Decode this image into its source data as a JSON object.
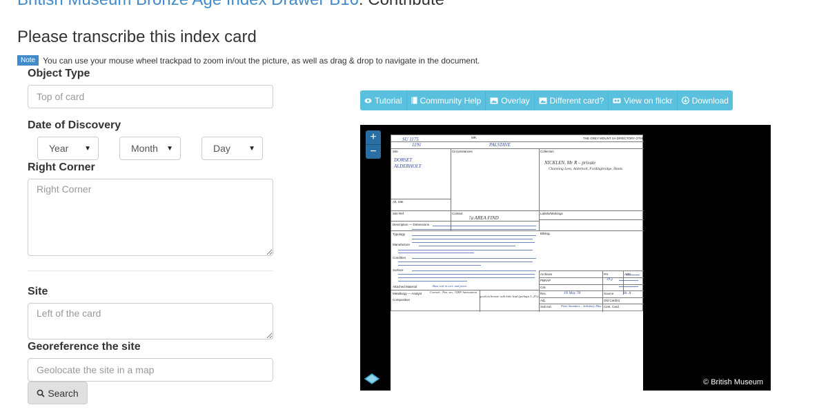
{
  "header": {
    "project_link": "British Museum Bronze Age Index Drawer B16",
    "separator": ": Contribute",
    "subtitle": "Please transcribe this index card"
  },
  "note": {
    "badge": "Note",
    "text": "You can use your mouse wheel trackpad to zoom in/out the picture, as well as drag & drop to navigate in the document."
  },
  "form": {
    "object_type_label": "Object Type",
    "object_type_placeholder": "Top of card",
    "date_label": "Date of Discovery",
    "year": "Year",
    "month": "Month",
    "day": "Day",
    "right_corner_label": "Right Corner",
    "right_corner_placeholder": "Right Corner",
    "site_label": "Site",
    "site_placeholder": "Left of the card",
    "georef_label": "Georeference the site",
    "georef_placeholder": "Geolocate the site in a map",
    "search_label": "Search"
  },
  "toolbar": {
    "tutorial": "Tutorial",
    "community_help": "Community Help",
    "overlay": "Overlay",
    "different_card": "Different card?",
    "view_on_flickr": "View on flickr",
    "download": "Download"
  },
  "viewer": {
    "zoom_in": "+",
    "zoom_out": "−",
    "credit": "© British Museum"
  },
  "card": {
    "hw_ref": "SU 1175",
    "hw_ref2": "1191",
    "hw_place": "PALSTAVE",
    "hw_county": "DORSET",
    "hw_parish": "ALDERHOLT",
    "hw_collection": "NICKLEN, Mr R   – private",
    "hw_address": "Channing Lees, Alderholt, Fordingbridge, Hants",
    "hw_context": "?a   AREA FIND",
    "site_label": "Site",
    "circumstances_label": "Circumstances",
    "collection_label": "Collection",
    "alt_site_label": "Alt. Site",
    "site_ref_label": "Site Ref.",
    "context_label": "Context",
    "labels_label": "Labels/Markings",
    "bibliog_label": "Bibliog.",
    "description_label": "Description — Dimensions",
    "typology_label": "Typology",
    "manufacture_label": "Manufacture",
    "condition_label": "Condition",
    "surface_label": "Surface",
    "attached_label": "Attached Material",
    "metallurgy_label": "Metallurgy — Analyst",
    "composition_label": "Composition",
    "archives_label": "Archives",
    "pbrap_label": "PBRAP",
    "cat_label": "Cat.",
    "rec_label": "Rec.",
    "adj_label": "Adj.",
    "sub_label": "Sub Ind.",
    "ph_label": "PH",
    "apd_label": "APD",
    "source_label": "Source",
    "old_card_label": "Old Card(s)",
    "cent_card_label": "Cent. Card",
    "hw_rec": "JN   May 78",
    "hw_source": "Sh. A",
    "hw_sub": "Peter Saunders – Salisbury Mus.",
    "hw_pbrap": "39 g",
    "hw_metallurgy": "Conrad – Pen. sec.   ?XRF Attenuation",
    "hw_metallurgy2": "good tin bronze with little lead (perhaps 1–2%)",
    "hw_attached": "Base soil in corr. and pores",
    "header_mid": "MR.",
    "header_right": "THE GREY MOUNT SA DIRECTORY OTHE"
  }
}
